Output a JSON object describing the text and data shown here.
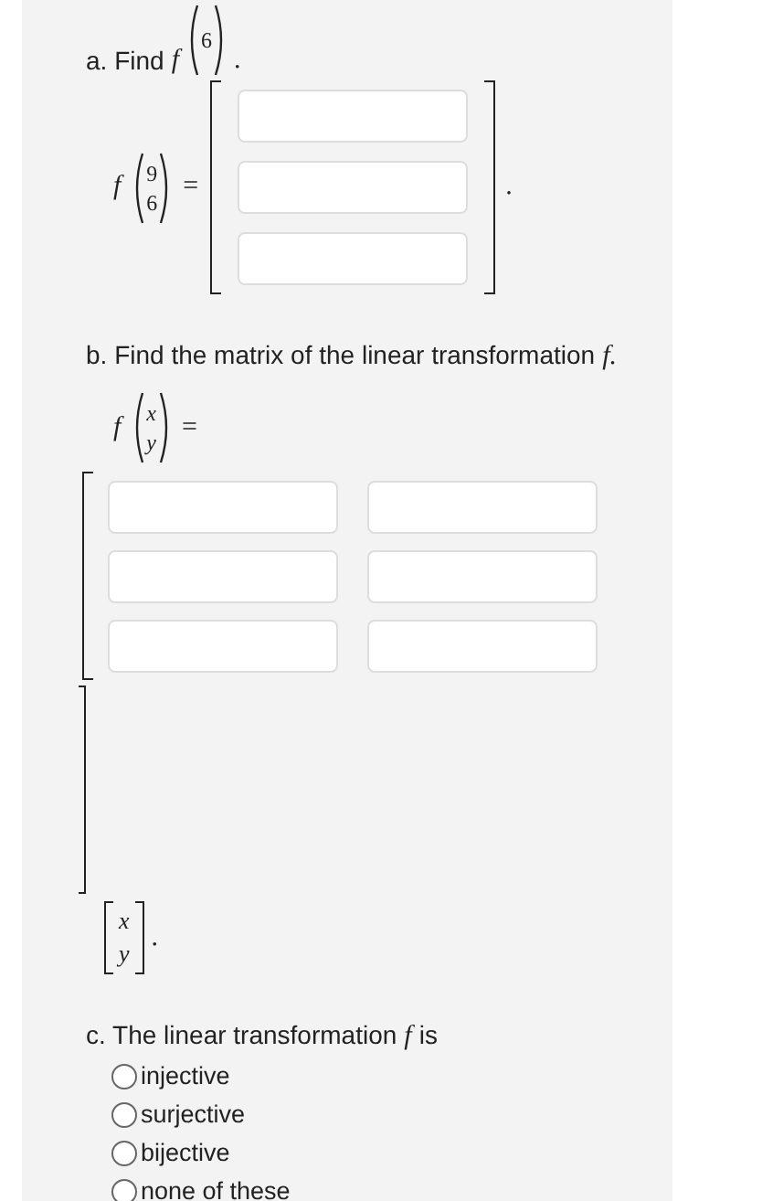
{
  "part_a": {
    "prompt": "a. Find",
    "func": "f",
    "point_visible": [
      "6"
    ],
    "end": ".",
    "equation": {
      "func": "f",
      "vector": [
        "9",
        "6"
      ],
      "equals": "=",
      "answers": [
        {
          "kind": "blank"
        },
        {
          "kind": "blank"
        },
        {
          "kind": "blank"
        }
      ],
      "end": "."
    }
  },
  "part_b": {
    "prompt": "b. Find the matrix of the linear transformation",
    "func": "f",
    "end": ".",
    "equation": {
      "func": "f",
      "vector": [
        "x",
        "y"
      ],
      "equals": "=",
      "matrix": [
        [
          {
            "kind": "blank"
          },
          {
            "kind": "blank"
          }
        ],
        [
          {
            "kind": "blank"
          },
          {
            "kind": "blank"
          }
        ],
        [
          {
            "kind": "blank"
          },
          {
            "kind": "blank"
          }
        ]
      ],
      "vector_after": [
        "x",
        "y"
      ],
      "end": "."
    }
  },
  "part_c": {
    "prompt": "c. The linear transformation",
    "func": "f",
    "after": "is",
    "options": [
      {
        "label": "injective",
        "selected": false
      },
      {
        "label": "surjective",
        "selected": false
      },
      {
        "label": "bijective",
        "selected": false
      },
      {
        "label": "none of these",
        "selected": false
      }
    ]
  }
}
